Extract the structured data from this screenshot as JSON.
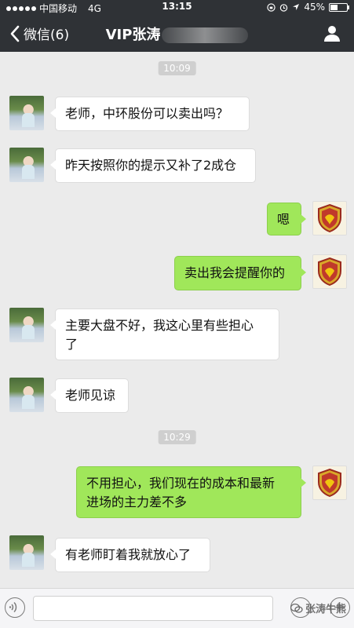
{
  "status_bar": {
    "carrier": "中国移动",
    "network": "4G",
    "time": "13:15",
    "battery": "45%",
    "battery_level": 0.45
  },
  "nav": {
    "back_label": "微信(6)",
    "title": "VIP张涛"
  },
  "chat": {
    "time_1": "10:09",
    "time_2": "10:29",
    "messages": [
      {
        "side": "in",
        "text": "老师，中环股份可以卖出吗？"
      },
      {
        "side": "in",
        "text": "昨天按照你的提示又补了2成仓"
      },
      {
        "side": "out",
        "text": "嗯"
      },
      {
        "side": "out",
        "text": "卖出我会提醒你的"
      },
      {
        "side": "in",
        "text_line1": "主要大盘不好，我这心里有些担心",
        "text_line2": "了"
      },
      {
        "side": "in",
        "text": "老师见谅"
      },
      {
        "side": "out",
        "text_line1": "不用担心，我们现在的成本和最新",
        "text_line2": "进场的主力差不多"
      },
      {
        "side": "in",
        "text": "有老师盯着我就放心了"
      }
    ]
  },
  "input": {
    "watermark": "张涛牛熊"
  },
  "colors": {
    "bar_bg": "#2f3236",
    "chat_bg": "#ebebeb",
    "out_bubble": "#a0e75a",
    "in_bubble": "#ffffff"
  },
  "icons": {
    "back": "chevron-left-icon",
    "profile": "person-icon",
    "voice": "voice-icon",
    "emoji": "emoji-icon",
    "plus": "plus-icon"
  }
}
